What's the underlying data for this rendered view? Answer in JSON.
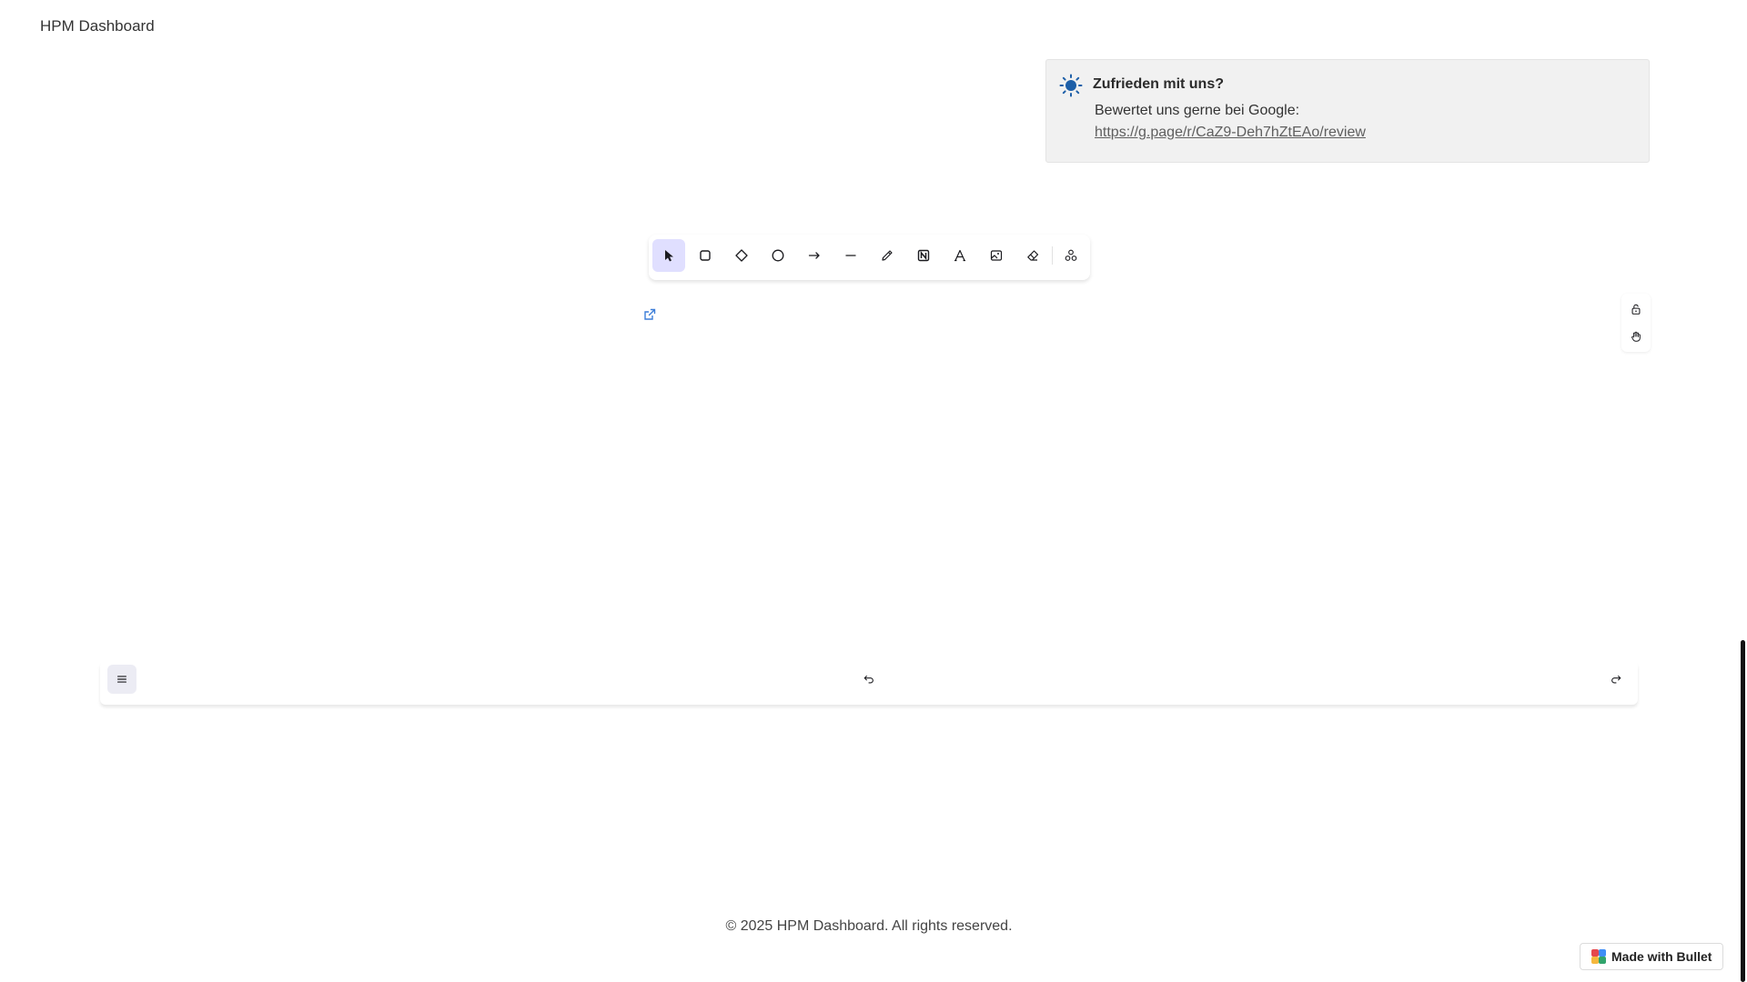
{
  "header": {
    "title": "HPM Dashboard"
  },
  "callout": {
    "title": "Zufrieden mit uns?",
    "text": "Bewertet uns gerne bei Google:",
    "link": "https://g.page/r/CaZ9-Deh7hZtEAo/review",
    "icon": "sun-icon"
  },
  "toolbar": {
    "tools": [
      {
        "name": "selection",
        "icon": "pointer-icon",
        "active": true
      },
      {
        "name": "rectangle",
        "icon": "rectangle-icon"
      },
      {
        "name": "diamond",
        "icon": "diamond-icon"
      },
      {
        "name": "ellipse",
        "icon": "ellipse-icon"
      },
      {
        "name": "arrow",
        "icon": "arrow-icon"
      },
      {
        "name": "line",
        "icon": "line-icon"
      },
      {
        "name": "draw",
        "icon": "pencil-icon"
      },
      {
        "name": "frame",
        "icon": "frame-icon"
      },
      {
        "name": "text",
        "icon": "text-icon"
      },
      {
        "name": "image",
        "icon": "image-icon"
      },
      {
        "name": "eraser",
        "icon": "eraser-icon"
      },
      {
        "name": "more",
        "icon": "shapes-icon"
      }
    ],
    "active_color": "#e0dfff"
  },
  "side_controls": [
    {
      "icon": "lock-icon"
    },
    {
      "icon": "hand-icon"
    }
  ],
  "bottom_bar": {
    "menu_icon": "hamburger-icon",
    "undo_icon": "undo-icon",
    "redo_icon": "redo-icon"
  },
  "footer": {
    "text": "© 2025 HPM Dashboard. All rights reserved."
  },
  "badge": {
    "label": "Made with Bullet"
  },
  "colors": {
    "accent": "#e0dfff",
    "sun": "#1d5fa8",
    "link": "#5f5f5f"
  }
}
